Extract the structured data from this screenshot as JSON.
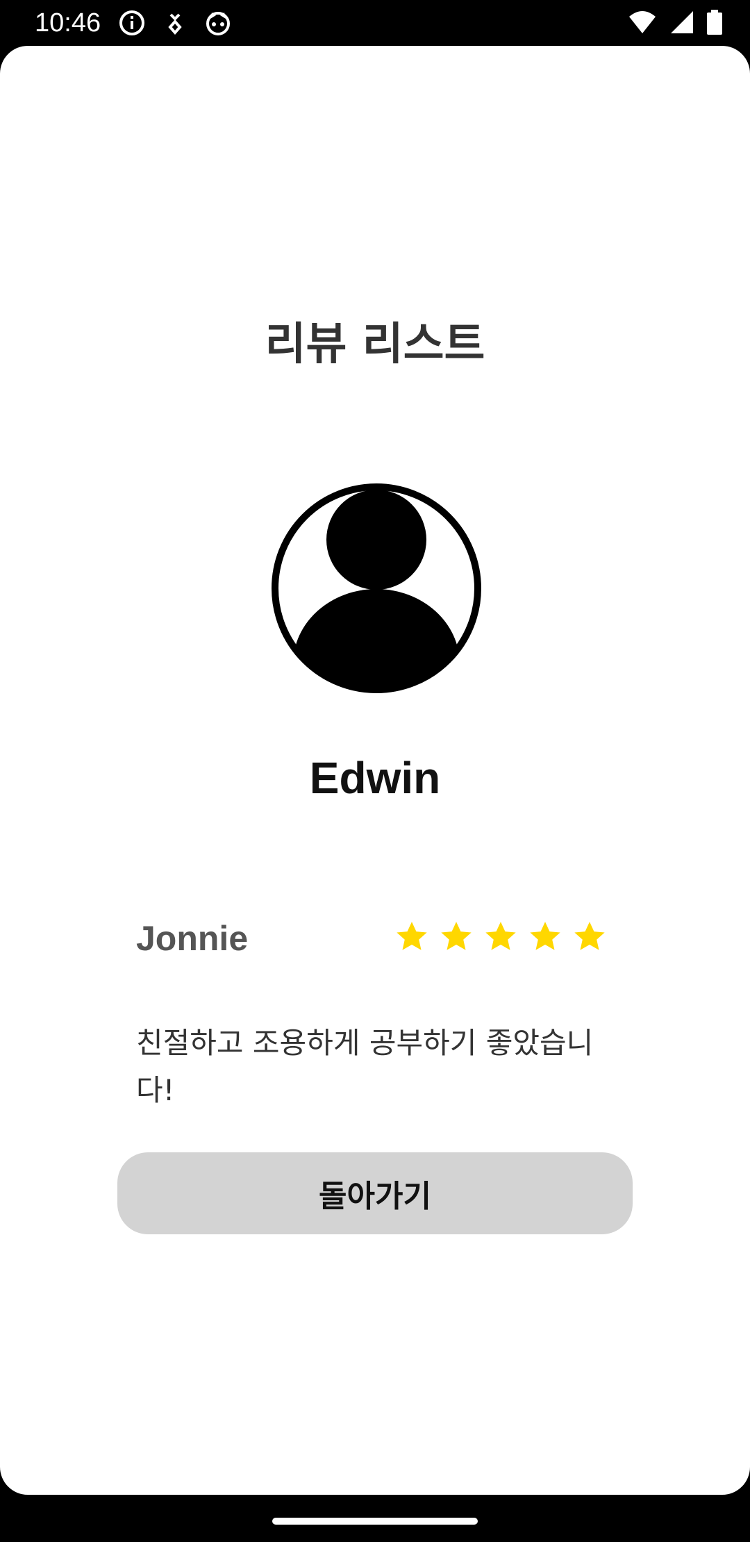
{
  "status_bar": {
    "time": "10:46",
    "left_icons": [
      "info-icon",
      "download-icon",
      "cat-face-icon"
    ],
    "right_icons": [
      "wifi-icon",
      "cell-signal-icon",
      "battery-icon"
    ]
  },
  "page": {
    "title": "리뷰 리스트"
  },
  "profile": {
    "avatar_icon": "user-avatar-icon",
    "name": "Edwin"
  },
  "review": {
    "reviewer": "Jonnie",
    "rating": 5,
    "rating_max": 5,
    "text": "친절하고 조용하게 공부하기 좋았습니다!"
  },
  "actions": {
    "back_label": "돌아가기"
  },
  "colors": {
    "star": "#FFD700",
    "button_bg": "#D3D3D3",
    "title": "#333333"
  }
}
